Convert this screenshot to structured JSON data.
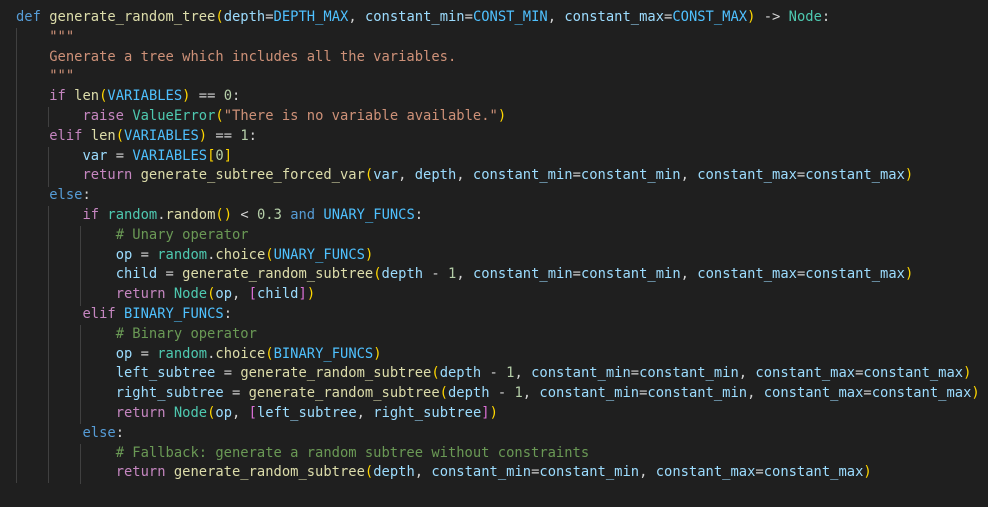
{
  "editor": {
    "language": "python",
    "theme_background": "#1f1f1f",
    "lines": [
      "def generate_random_tree(depth=DEPTH_MAX, constant_min=CONST_MIN, constant_max=CONST_MAX) -> Node:",
      "    \"\"\"",
      "    Generate a tree which includes all the variables.",
      "    \"\"\"",
      "    if len(VARIABLES) == 0:",
      "        raise ValueError(\"There is no variable available.\")",
      "    elif len(VARIABLES) == 1:",
      "        var = VARIABLES[0]",
      "        return generate_subtree_forced_var(var, depth, constant_min=constant_min, constant_max=constant_max)",
      "    else:",
      "        if random.random() < 0.3 and UNARY_FUNCS:",
      "            # Unary operator",
      "            op = random.choice(UNARY_FUNCS)",
      "            child = generate_random_subtree(depth - 1, constant_min=constant_min, constant_max=constant_max)",
      "            return Node(op, [child])",
      "        elif BINARY_FUNCS:",
      "            # Binary operator",
      "            op = random.choice(BINARY_FUNCS)",
      "            left_subtree = generate_random_subtree(depth - 1, constant_min=constant_min, constant_max=constant_max)",
      "            right_subtree = generate_random_subtree(depth - 1, constant_min=constant_min, constant_max=constant_max)",
      "            return Node(op, [left_subtree, right_subtree])",
      "        else:",
      "            # Fallback: generate a random subtree without constraints",
      "            return generate_random_subtree(depth, constant_min=constant_min, constant_max=constant_max)"
    ]
  }
}
